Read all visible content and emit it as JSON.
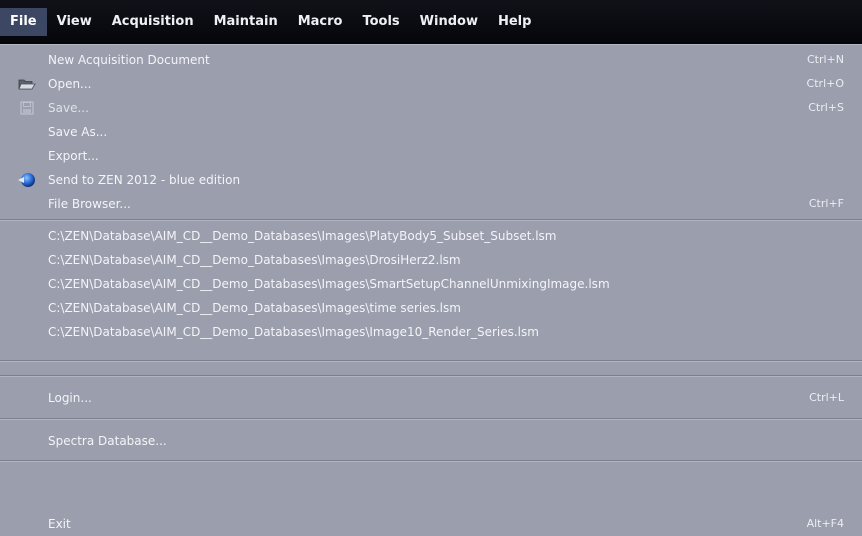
{
  "menubar": {
    "items": [
      {
        "label": "File"
      },
      {
        "label": "View"
      },
      {
        "label": "Acquisition"
      },
      {
        "label": "Maintain"
      },
      {
        "label": "Macro"
      },
      {
        "label": "Tools"
      },
      {
        "label": "Window"
      },
      {
        "label": "Help"
      }
    ],
    "active_color": "#3c4763"
  },
  "file_menu": {
    "new_doc": {
      "label": "New Acquisition Document",
      "shortcut": "Ctrl+N"
    },
    "open": {
      "label": "Open...",
      "shortcut": "Ctrl+O",
      "icon": "folder-icon"
    },
    "save": {
      "label": "Save...",
      "shortcut": "Ctrl+S",
      "icon": "floppy-disk-icon"
    },
    "save_as": {
      "label": "Save As..."
    },
    "export": {
      "label": "Export..."
    },
    "send_to_zen": {
      "label": "Send to ZEN 2012 - blue edition",
      "icon": "blue-globe-icon"
    },
    "file_browser": {
      "label": "File Browser...",
      "shortcut": "Ctrl+F"
    },
    "recent_files": [
      "C:\\ZEN\\Database\\AIM_CD__Demo_Databases\\Images\\PlatyBody5_Subset_Subset.lsm",
      "C:\\ZEN\\Database\\AIM_CD__Demo_Databases\\Images\\DrosiHerz2.lsm",
      "C:\\ZEN\\Database\\AIM_CD__Demo_Databases\\Images\\SmartSetupChannelUnmixingImage.lsm",
      "C:\\ZEN\\Database\\AIM_CD__Demo_Databases\\Images\\time series.lsm",
      "C:\\ZEN\\Database\\AIM_CD__Demo_Databases\\Images\\Image10_Render_Series.lsm"
    ],
    "login": {
      "label": "Login...",
      "shortcut": "Ctrl+L"
    },
    "spectra_db": {
      "label": "Spectra Database..."
    },
    "exit": {
      "label": "Exit",
      "shortcut": "Alt+F4"
    }
  }
}
